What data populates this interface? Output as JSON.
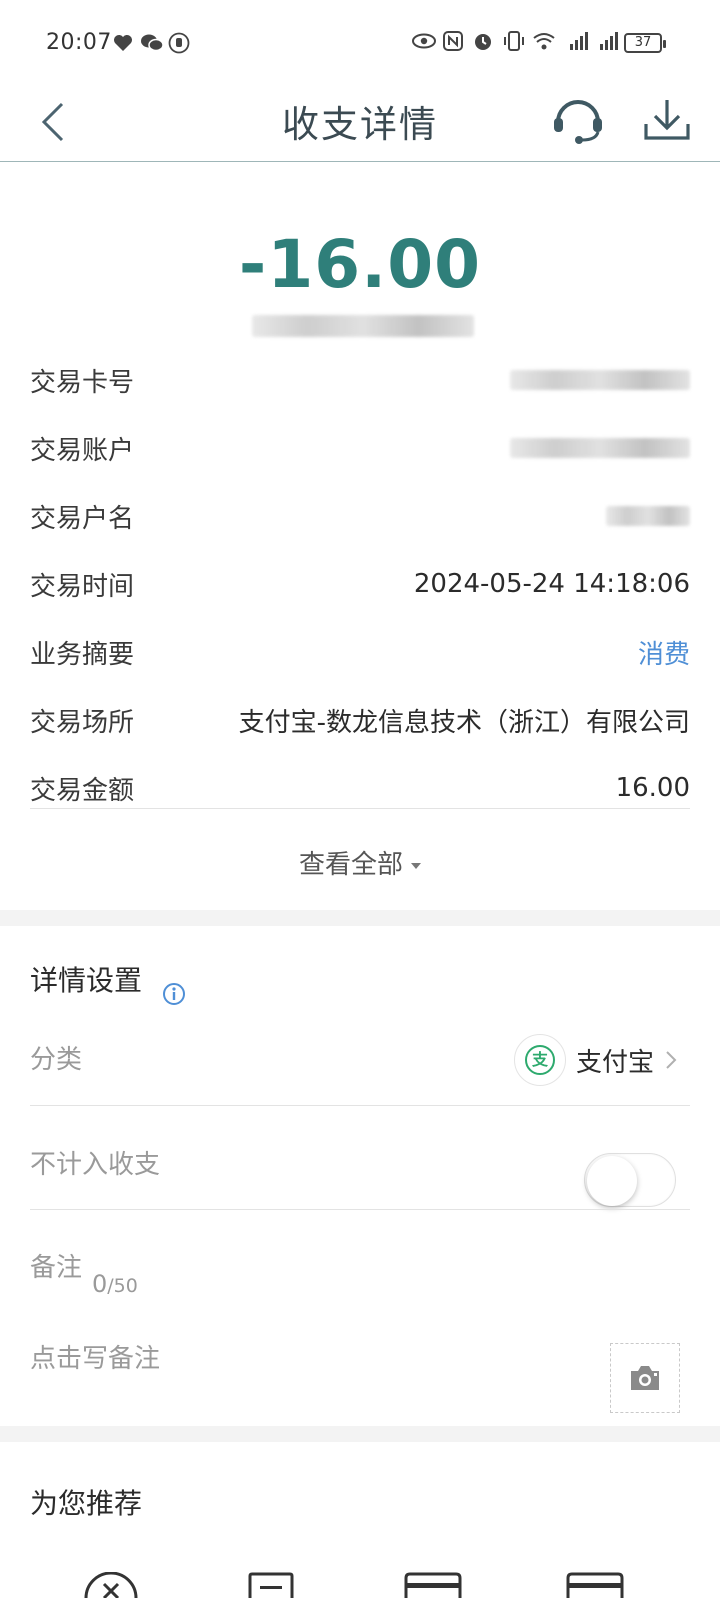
{
  "status_bar": {
    "time": "20:07",
    "battery": "37"
  },
  "nav": {
    "title": "收支详情",
    "back_icon": "back-chevron-icon",
    "service_icon": "headset-icon",
    "download_icon": "download-icon"
  },
  "transaction": {
    "amount": "-16.00"
  },
  "details": [
    {
      "label": "交易卡号",
      "value": ""
    },
    {
      "label": "交易账户",
      "value": ""
    },
    {
      "label": "交易户名",
      "value": ""
    },
    {
      "label": "交易时间",
      "value": "2024-05-24 14:18:06"
    },
    {
      "label": "业务摘要",
      "value": "消费"
    },
    {
      "label": "交易场所",
      "value": "支付宝-数龙信息技术（浙江）有限公司"
    },
    {
      "label": "交易金额",
      "value": "16.00"
    }
  ],
  "view_all": "查看全部",
  "settings": {
    "title": "详情设置",
    "category_label": "分类",
    "category_value": "支付宝",
    "category_icon_char": "支",
    "exclude_label": "不计入收支",
    "exclude_enabled": false,
    "note_label": "备注",
    "note_count": "0",
    "note_max": "/50",
    "note_placeholder": "点击写备注"
  },
  "recommend": {
    "title": "为您推荐"
  },
  "colors": {
    "amount": "#2f7f7a",
    "link": "#4f8fd6",
    "category_green": "#2eaa6e"
  }
}
